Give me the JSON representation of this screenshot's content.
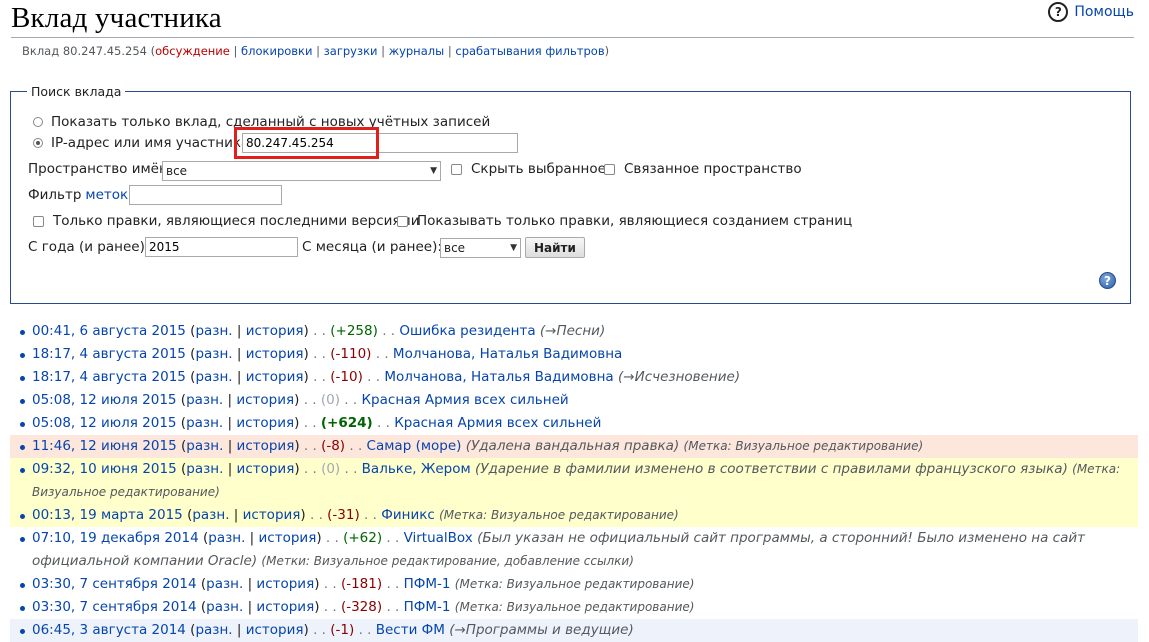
{
  "page": {
    "title": "Вклад участника",
    "help_label": "Помощь",
    "subtitle": {
      "prefix": "Вклад 80.247.45.254",
      "discussion": "обсуждение",
      "blocks": "блокировки",
      "uploads": "загрузки",
      "logs": "журналы",
      "filters": "срабатывания фильтров"
    }
  },
  "form": {
    "legend": "Поиск вклада",
    "radio_new_accounts": "Показать только вклад, сделанный с новых учётных записей",
    "radio_ip": "IP-адрес или имя участника:",
    "ip_value": "80.247.45.254",
    "namespace_label": "Пространство имён:",
    "namespace_value": "все",
    "hide_selected": "Скрыть выбранное",
    "associated_ns": "Связанное пространство",
    "tag_filter_prefix": "Фильтр",
    "tag_filter_link": "меток:",
    "tag_filter_value": "",
    "only_latest": "Только правки, являющиеся последними версиями",
    "only_creations": "Показывать только правки, являющиеся созданием страниц",
    "year_label": "С года (и ранее):",
    "year_value": "2015",
    "month_label": "С месяца (и ранее):",
    "month_value": "все",
    "submit": "Найти"
  },
  "colors": {
    "row_red": "#fde6dc",
    "row_yellow": "#ffffcc",
    "row_blue": "#eef3fb"
  },
  "contributions": [
    {
      "date": "00:41, 6 августа 2015",
      "diff": "разн.",
      "hist": "история",
      "size": "(+258)",
      "size_class": "pos",
      "page": "Ошибка резидента",
      "comment": "(→Песни)",
      "tag": "",
      "bg": ""
    },
    {
      "date": "18:17, 4 августа 2015",
      "diff": "разн.",
      "hist": "история",
      "size": "(-110)",
      "size_class": "neg",
      "page": "Молчанова, Наталья Вадимовна",
      "comment": "",
      "tag": "",
      "bg": ""
    },
    {
      "date": "18:17, 4 августа 2015",
      "diff": "разн.",
      "hist": "история",
      "size": "(-10)",
      "size_class": "neg",
      "page": "Молчанова, Наталья Вадимовна",
      "comment": "(→Исчезновение)",
      "tag": "",
      "bg": ""
    },
    {
      "date": "05:08, 12 июля 2015",
      "diff": "разн.",
      "hist": "история",
      "size": "(0)",
      "size_class": "zero",
      "page": "Красная Армия всех сильней",
      "comment": "",
      "tag": "",
      "bg": ""
    },
    {
      "date": "05:08, 12 июля 2015",
      "diff": "разн.",
      "hist": "история",
      "size": "(+624)",
      "size_class": "posb",
      "page": "Красная Армия всех сильней",
      "comment": "",
      "tag": "",
      "bg": ""
    },
    {
      "date": "11:46, 12 июня 2015",
      "diff": "разн.",
      "hist": "история",
      "size": "(-8)",
      "size_class": "neg",
      "page": "Самар (море)",
      "comment": "(Удалена вандальная правка)",
      "tag": "(Метка: Визуальное редактирование)",
      "bg": "red"
    },
    {
      "date": "09:32, 10 июня 2015",
      "diff": "разн.",
      "hist": "история",
      "size": "(0)",
      "size_class": "zero",
      "page": "Вальке, Жером",
      "comment": "(Ударение в фамилии изменено в соответствии с правилами французского языка)",
      "tag": "(Метка: Визуальное редактирование)",
      "bg": "yellow"
    },
    {
      "date": "00:13, 19 марта 2015",
      "diff": "разн.",
      "hist": "история",
      "size": "(-31)",
      "size_class": "neg",
      "page": "Финикс",
      "comment": "",
      "tag": "(Метка: Визуальное редактирование)",
      "bg": "yellow"
    },
    {
      "date": "07:10, 19 декабря 2014",
      "diff": "разн.",
      "hist": "история",
      "size": "(+62)",
      "size_class": "pos",
      "page": "VirtualBox",
      "comment": "(Был указан не официальный сайт программы, а сторонний! Было изменено на сайт официальной компании Oracle)",
      "tag": "(Метки: Визуальное редактирование, добавление ссылки)",
      "bg": ""
    },
    {
      "date": "03:30, 7 сентября 2014",
      "diff": "разн.",
      "hist": "история",
      "size": "(-181)",
      "size_class": "neg",
      "page": "ПФМ-1",
      "comment": "",
      "tag": "(Метка: Визуальное редактирование)",
      "bg": ""
    },
    {
      "date": "03:30, 7 сентября 2014",
      "diff": "разн.",
      "hist": "история",
      "size": "(-328)",
      "size_class": "neg",
      "page": "ПФМ-1",
      "comment": "",
      "tag": "(Метка: Визуальное редактирование)",
      "bg": ""
    },
    {
      "date": "06:45, 3 августа 2014",
      "diff": "разн.",
      "hist": "история",
      "size": "(-1)",
      "size_class": "neg",
      "page": "Вести ФМ",
      "comment": "(→Программы и ведущие)",
      "tag": "",
      "bg": "blue"
    }
  ]
}
